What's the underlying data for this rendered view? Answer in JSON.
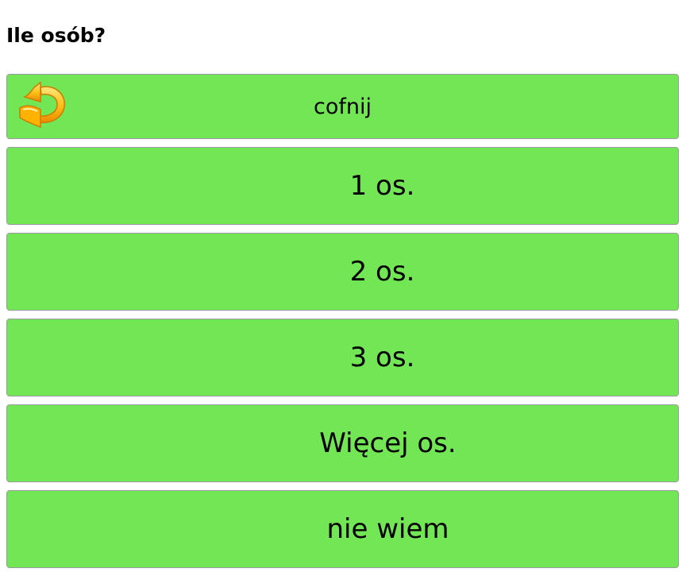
{
  "heading": "Ile osób?",
  "back_button": {
    "label": "cofnij",
    "icon": "undo-arrow-icon",
    "icon_color": "#f5a300"
  },
  "options": [
    {
      "label": "1 os."
    },
    {
      "label": "2 os."
    },
    {
      "label": "3 os."
    },
    {
      "label": "Więcej os."
    },
    {
      "label": "nie wiem"
    }
  ],
  "colors": {
    "button_bg": "#72e655",
    "button_border": "#9a9a9a"
  }
}
